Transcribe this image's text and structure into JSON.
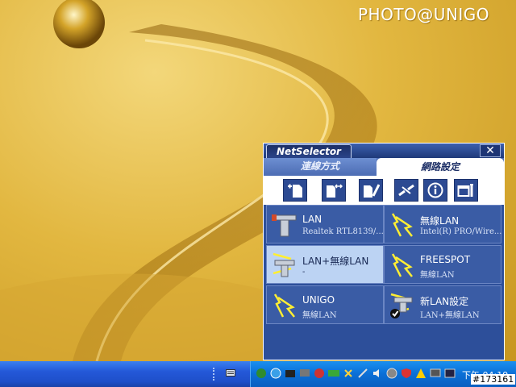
{
  "desktop": {
    "watermark": "PHOTO@UNIGO",
    "colors": {
      "gold_light": "#f3d77a",
      "gold_mid": "#e2b740",
      "gold_dark": "#a06d10"
    }
  },
  "window": {
    "title": "NetSelector",
    "close_label": "✕",
    "tabs": [
      {
        "label": "連線方式",
        "active": false
      },
      {
        "label": "網路設定",
        "active": true
      }
    ],
    "toolbar": [
      {
        "icon": "new-profile-icon"
      },
      {
        "icon": "copy-profile-icon"
      },
      {
        "icon": "edit-profile-icon"
      },
      {
        "icon": "disconnect-icon"
      },
      {
        "icon": "info-icon"
      },
      {
        "icon": "settings-icon"
      }
    ],
    "connections": [
      {
        "name": "LAN",
        "detail": "Realtek RTL8139/...",
        "icon": "lan-icon",
        "selected": false
      },
      {
        "name": "無線LAN",
        "detail": "Intel(R) PRO/Wire...",
        "icon": "wireless-icon",
        "selected": false
      },
      {
        "name": "LAN+無線LAN",
        "detail": "-",
        "icon": "lan-wireless-icon",
        "selected": true
      },
      {
        "name": "FREESPOT",
        "detail": "無線LAN",
        "icon": "wireless-icon",
        "selected": false
      },
      {
        "name": "UNIGO",
        "detail": "無線LAN",
        "icon": "wireless-icon",
        "selected": false
      },
      {
        "name": "新LAN設定",
        "detail": "LAN+無線LAN",
        "icon": "lan-wireless-check-icon",
        "selected": false
      }
    ],
    "colors": {
      "panel": "#2d4f9a",
      "item": "#3a5ca5",
      "selected": "#bcd3f3"
    }
  },
  "taskbar": {
    "clock": "下午 04:19",
    "image_id": "#173161"
  }
}
